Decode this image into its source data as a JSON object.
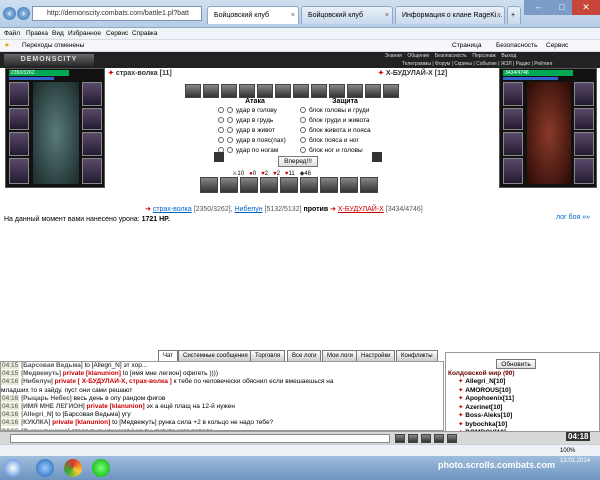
{
  "browser": {
    "address": "http://demonscity.combats.com/battle1.pl?batt",
    "tabs": [
      "Бойцовский клуб",
      "Бойцовский клуб",
      "Информация о клане RageKi..."
    ],
    "menu": [
      "Файл",
      "Правка",
      "Вид",
      "Избранное",
      "Сервис",
      "Справка"
    ],
    "fav": "Переходы отменены",
    "cmd": [
      "Страница",
      "Безопасность",
      "Сервис"
    ]
  },
  "game": {
    "logo": "DEMONSCITY",
    "topnav1": [
      "Знания",
      "Общение",
      "Безопасность",
      "Персонаж",
      "Выход"
    ],
    "topnav2": "Телеграммы | Форум | Скрины | Событие | ЖЗЛ | Радио | Рейтинг",
    "left_name": "страх-волка [11]",
    "right_name": "Х-БУДУЛАЙ-Х [12]",
    "left_hp": "2350/3262",
    "right_hp": "3434/4746",
    "attack_title": "Атака",
    "defense_title": "Защита",
    "attacks": [
      "удар в голову",
      "удар в грудь",
      "удар в живот",
      "удар в пояс(пах)",
      "удар по ногам"
    ],
    "defenses": [
      "блок головы и груди",
      "блок груди и живота",
      "блок живота и пояса",
      "блок пояса и ног",
      "блок ног и головы"
    ],
    "forward_btn": "Вперед!!!",
    "stats": [
      "10",
      "0",
      "2",
      "2",
      "11",
      "46"
    ],
    "battle_left": "страх-волка",
    "battle_left_hp": "[2350/3262],",
    "battle_mid": "Нибелун",
    "battle_mid_hp": "[5132/5132]",
    "vs": "против",
    "battle_right": "Х-БУДУЛАЙ-Х",
    "battle_right_hp": "[3434/4746]",
    "damage_text": "На данный момент вами нанесено урона:",
    "damage_value": "1721 HP.",
    "log_link": "лог боя »»"
  },
  "chat": {
    "tabs": [
      "Чат",
      "Системные сообщения",
      "Торговля",
      "Все логи",
      "Мои логи",
      "Настройки",
      "Конфликты"
    ],
    "messages": [
      {
        "t": "04:15",
        "n": "Барсовая Ведьма",
        "p": "",
        "r": "to [Allegri_N] эт хор..."
      },
      {
        "t": "04:15",
        "n": "Медвежуть",
        "p": "private [klanunion]",
        "r": "to [имя мне легион] офигеть ))))"
      },
      {
        "t": "04:16",
        "n": "Нибелун",
        "p": "private [ Х-БУДУЛАЙ-Х, страх-волка ]",
        "r": "к тебе по человечески обяснил если вмешаешься на"
      },
      {
        "t": "",
        "n": "",
        "p": "",
        "r": "младших то я зайду. пуст они сами решают"
      },
      {
        "t": "04:16",
        "n": "Рыцарь Небес",
        "p": "",
        "r": "весь день в опу рандом фигов"
      },
      {
        "t": "04:16",
        "n": "ИМЯ МНЕ ЛЕГИОН",
        "p": "private [klanunion]",
        "r": "эх а ещё плащ на 12-й нужен"
      },
      {
        "t": "04:16",
        "n": "Allegri_N",
        "p": "",
        "r": "to [Барсовая Ведьма] угу"
      },
      {
        "t": "04:16",
        "n": "КУКЛКА",
        "p": "private [klanunion]",
        "r": "to [Медвежуть] рунка сила +2 в кольцо не надо тебе?"
      },
      {
        "t": "04:16",
        "n": "О ком тишина",
        "p": "",
        "r": "стадо тыськащиков ! че вы лупите кого попало"
      },
      {
        "t": "04:16",
        "n": "Х-БУДУЛАЙ-Х",
        "p": "private [ страх-волка ]",
        "r": "бляднна гасись когда его не будет !!!"
      },
      {
        "t": "04:16",
        "n": "Медвежуть",
        "p": "private [klanunion]",
        "r": "to [КУКЛКА] надо но кр нету (((("
      }
    ],
    "refresh": "Обновить",
    "world": "Колдовской мир (90)",
    "users": [
      "Allegri_N[10]",
      "AMOROUS[10]",
      "Apophoenix[11]",
      "Azerinet[10]",
      "Boss-Aleks[10]",
      "bybochka[10]",
      "DOMROV[10]"
    ],
    "clock": "04:18",
    "date": "13.01.2014"
  },
  "status": {
    "zoom": "100%"
  },
  "watermark": "photo.scrolls.combats.com"
}
